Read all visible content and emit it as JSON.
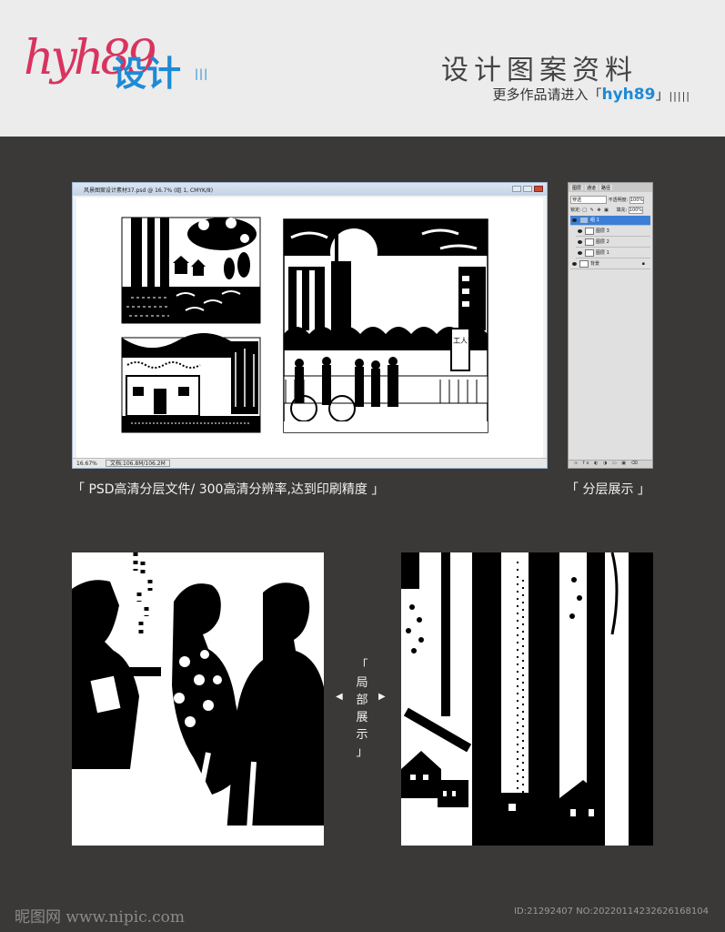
{
  "header": {
    "logo_letters": "hyh89",
    "logo_cn": "设计",
    "title": "设计图案资料",
    "subtitle_prefix": "更多作品请进入「",
    "subtitle_brand": "hyh89",
    "subtitle_suffix": "」"
  },
  "ps_window": {
    "title": "风景图案设计素材37.psd @ 16.7% (组 1, CMYK/8)",
    "zoom": "16.67%",
    "doc_size": "文档:106.8M/106.2M",
    "sign_text": "工人食堂"
  },
  "layers_panel": {
    "tabs": [
      "图层",
      "通道",
      "路径"
    ],
    "blend_mode": "穿透",
    "opacity_label": "不透明度:",
    "opacity_value": "100%",
    "lock_label": "锁定:",
    "fill_label": "填充:",
    "fill_value": "100%",
    "layers": [
      {
        "name": "组 1",
        "selected": true
      },
      {
        "name": "图层 3",
        "selected": false
      },
      {
        "name": "图层 2",
        "selected": false
      },
      {
        "name": "图层 1",
        "selected": false
      },
      {
        "name": "背景",
        "selected": false
      }
    ]
  },
  "captions": {
    "left": "「 PSD高清分层文件/ 300高清分辨率,达到印刷精度 」",
    "right": "「 分层展示 」"
  },
  "detail_label": [
    "「",
    "局",
    "部",
    "展",
    "示",
    "」"
  ],
  "footer": {
    "left": "昵图网 www.nipic.com",
    "right": "ID:21292407 NO:20220114232626168104"
  }
}
